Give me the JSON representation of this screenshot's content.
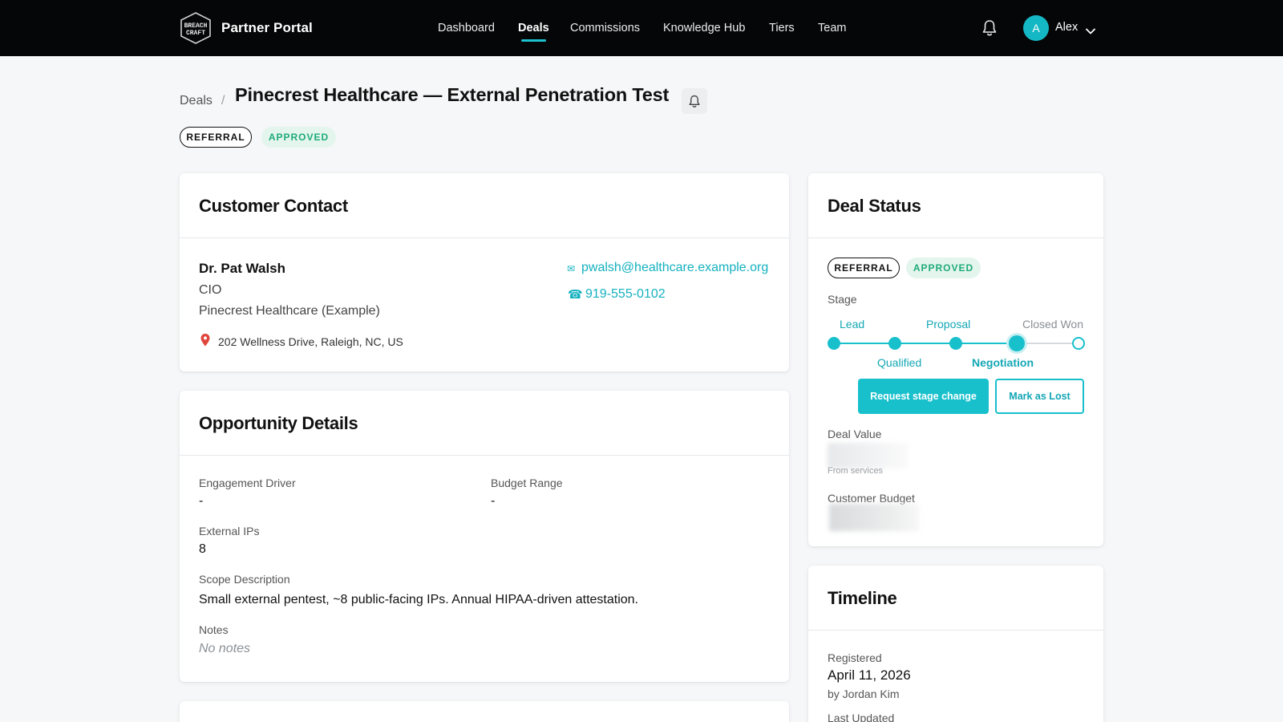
{
  "app": {
    "brand": "Partner Portal",
    "logo_text": [
      "BREACH",
      "CRAFT"
    ],
    "accent_color": "#18c0cc"
  },
  "nav": {
    "items": [
      {
        "label": "Dashboard",
        "active": false
      },
      {
        "label": "Deals",
        "active": true
      },
      {
        "label": "Commissions",
        "active": false
      },
      {
        "label": "Knowledge Hub",
        "active": false
      },
      {
        "label": "Tiers",
        "active": false
      },
      {
        "label": "Team",
        "active": false
      }
    ],
    "user": {
      "initial": "A",
      "name": "Alex"
    }
  },
  "header": {
    "breadcrumb": "Deals",
    "separator": "/",
    "title": "Pinecrest Healthcare — External Penetration Test",
    "badges": [
      "REFERRAL",
      "APPROVED"
    ]
  },
  "contact": {
    "title": "Customer Contact",
    "name": "Dr. Pat Walsh",
    "role": "CIO",
    "company": "Pinecrest Healthcare (Example)",
    "address": "202 Wellness Drive, Raleigh, NC, US",
    "email": "pwalsh@healthcare.example.org",
    "phone": "919-555-0102"
  },
  "opportunity": {
    "title": "Opportunity Details",
    "engagement_driver_label": "Engagement Driver",
    "engagement_driver": "-",
    "budget_range_label": "Budget Range",
    "budget_range": "-",
    "external_ips_label": "External IPs",
    "external_ips": "8",
    "scope_label": "Scope Description",
    "scope": "Small external pentest, ~8 public-facing IPs. Annual HIPAA-driven attestation.",
    "notes_label": "Notes",
    "notes": "No notes"
  },
  "deal_status": {
    "title": "Deal Status",
    "badges": [
      "REFERRAL",
      "APPROVED"
    ],
    "stage_label": "Stage",
    "stages": [
      {
        "label": "Lead",
        "state": "done"
      },
      {
        "label": "Qualified",
        "state": "done"
      },
      {
        "label": "Proposal",
        "state": "done"
      },
      {
        "label": "Negotiation",
        "state": "current"
      },
      {
        "label": "Closed Won",
        "state": "pending"
      }
    ],
    "request_button": "Request stage change",
    "lost_button": "Mark as Lost",
    "deal_value_label": "Deal Value",
    "deal_value_note": "From services",
    "customer_budget_label": "Customer Budget"
  },
  "timeline": {
    "title": "Timeline",
    "registered_label": "Registered",
    "registered_date": "April 11, 2026",
    "registered_by": "by Jordan Kim",
    "last_updated_label": "Last Updated"
  }
}
